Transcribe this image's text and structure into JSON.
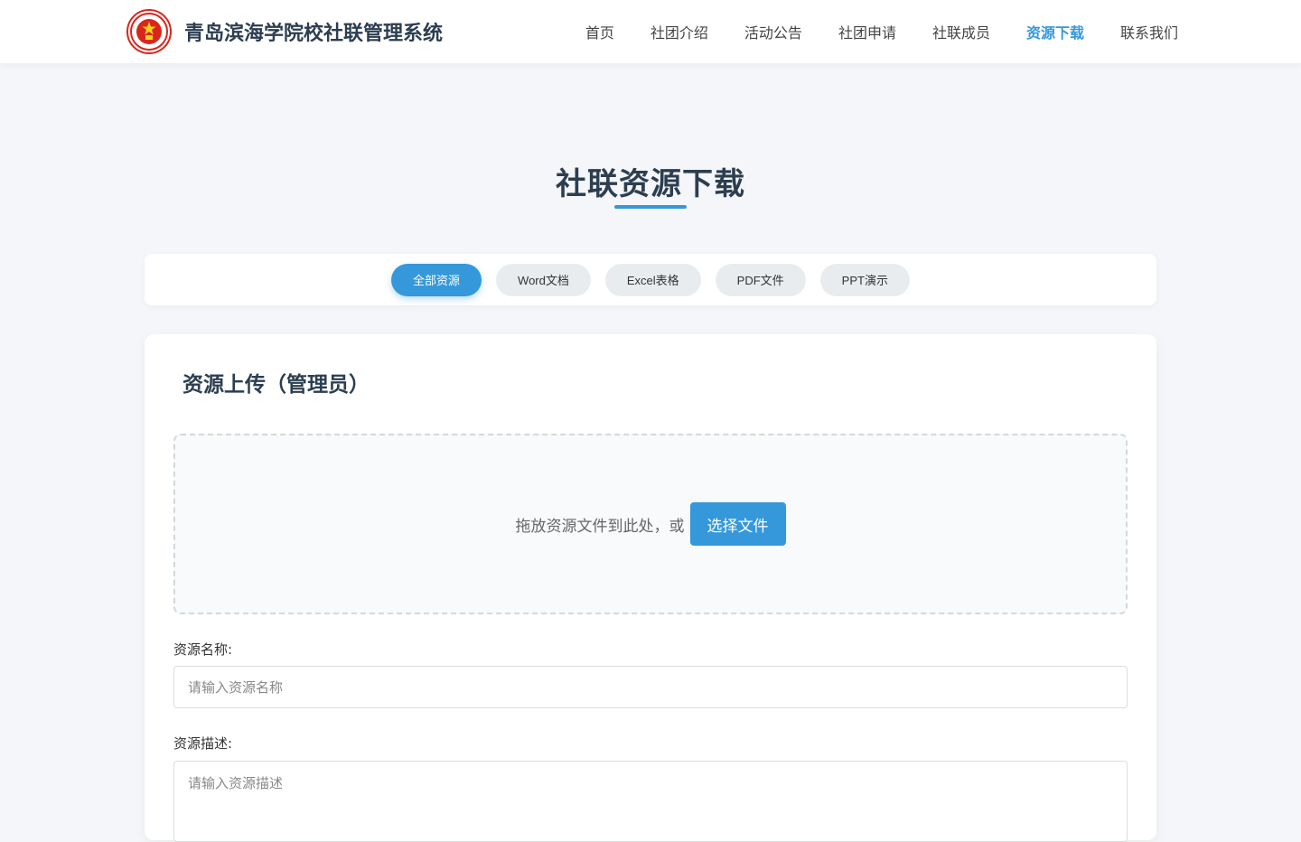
{
  "header": {
    "brand_title": "青岛滨海学院校社联管理系统",
    "logo_icon": "school-emblem-icon",
    "nav": [
      {
        "label": "首页",
        "active": false
      },
      {
        "label": "社团介绍",
        "active": false
      },
      {
        "label": "活动公告",
        "active": false
      },
      {
        "label": "社团申请",
        "active": false
      },
      {
        "label": "社联成员",
        "active": false
      },
      {
        "label": "资源下载",
        "active": true
      },
      {
        "label": "联系我们",
        "active": false
      }
    ]
  },
  "page": {
    "title": "社联资源下载"
  },
  "filters": [
    {
      "label": "全部资源",
      "active": true
    },
    {
      "label": "Word文档",
      "active": false
    },
    {
      "label": "Excel表格",
      "active": false
    },
    {
      "label": "PDF文件",
      "active": false
    },
    {
      "label": "PPT演示",
      "active": false
    }
  ],
  "upload": {
    "title": "资源上传（管理员）",
    "drop_text": "拖放资源文件到此处，或",
    "choose_label": "选择文件",
    "name_label": "资源名称:",
    "name_placeholder": "请输入资源名称",
    "desc_label": "资源描述:",
    "desc_placeholder": "请输入资源描述"
  },
  "colors": {
    "accent": "#3498db",
    "title": "#2c3e50",
    "background": "#f4f6f9",
    "logo_red": "#d9261c"
  }
}
